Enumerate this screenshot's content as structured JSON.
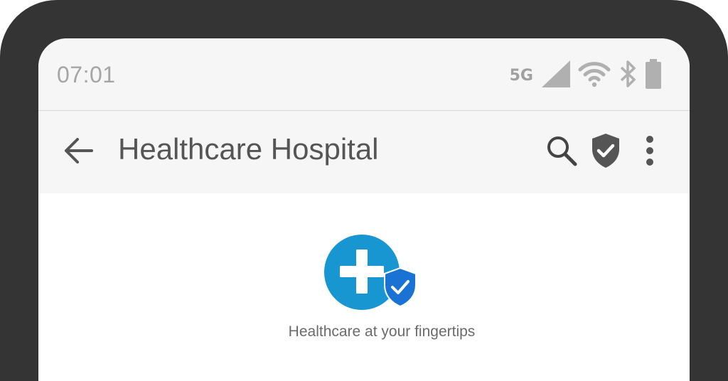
{
  "status_bar": {
    "time": "07:01",
    "network_type": "5G",
    "icons": [
      "signal-icon",
      "wifi-icon",
      "bluetooth-icon",
      "battery-icon"
    ]
  },
  "app_bar": {
    "title": "Healthcare Hospital",
    "back_icon": "arrow-left-icon",
    "actions": [
      "search-icon",
      "shield-check-icon",
      "more-vert-icon"
    ]
  },
  "content": {
    "logo_icon": "medical-cross-shield-icon",
    "tagline": "Healthcare at your fingertips"
  },
  "colors": {
    "frame": "#343434",
    "status_text": "#a5a5a5",
    "title_text": "#555555",
    "logo_circle": "#1796d2",
    "shield_blue": "#1a73d4"
  }
}
